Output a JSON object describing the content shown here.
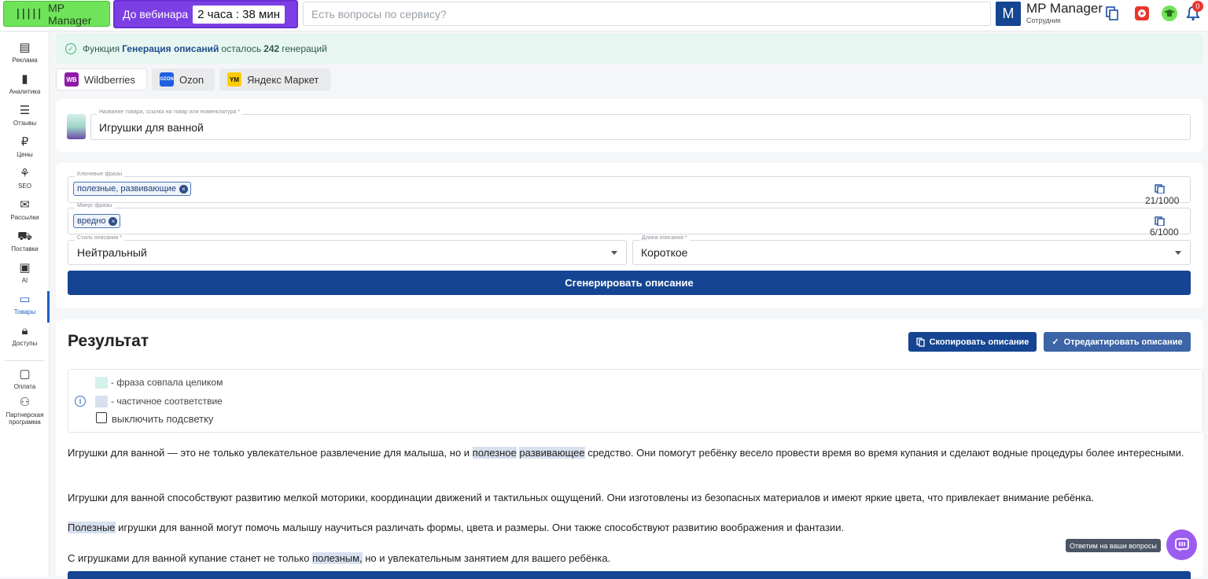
{
  "topbar": {
    "logo_label": "MP Manager",
    "webinar_label": "До вебинара",
    "webinar_timer": "2 часа : 38 мин",
    "search_placeholder": "Есть вопросы по сервису?",
    "user_initial": "M",
    "user_name": "MP Manager",
    "user_role": "Сотрудник",
    "notifications_count": "0"
  },
  "sidebar": {
    "items": [
      {
        "label": "Реклама",
        "icon": "ads-icon"
      },
      {
        "label": "Аналитика",
        "icon": "chart-icon"
      },
      {
        "label": "Отзывы",
        "icon": "reviews-icon"
      },
      {
        "label": "Цены",
        "icon": "ruble-icon"
      },
      {
        "label": "SEO",
        "icon": "seo-icon"
      },
      {
        "label": "Рассылки",
        "icon": "mail-icon"
      },
      {
        "label": "Поставки",
        "icon": "truck-icon"
      },
      {
        "label": "AI",
        "icon": "chip-icon"
      },
      {
        "label": "Товары",
        "icon": "box-icon"
      },
      {
        "label": "Доступы",
        "icon": "lock-icon"
      },
      {
        "label": "Оплата",
        "icon": "wallet-icon"
      },
      {
        "label": "Партнерская программа",
        "icon": "partners-icon"
      }
    ],
    "active": "Товары"
  },
  "banner": {
    "prefix": "Функция",
    "function_name": "Генерация описаний",
    "middle": "осталось",
    "count": "242",
    "suffix": "генераций"
  },
  "marketplaces": [
    {
      "label": "Wildberries",
      "logo": "WB",
      "color": "#8e1aa8"
    },
    {
      "label": "Ozon",
      "logo": "OZON",
      "color": "#1f5fe0"
    },
    {
      "label": "Яндекс Маркет",
      "logo": "YM",
      "color": "#ffcc00"
    }
  ],
  "product": {
    "label": "Название товара, ссылка на товар или номенклатура *",
    "value": "Игрушки для ванной"
  },
  "keywords": {
    "label": "Ключевые фразы",
    "chip": "полезные, развивающие",
    "counter": "21/1000"
  },
  "minus": {
    "label": "Минус фразы",
    "chip": "вредно",
    "counter": "6/1000"
  },
  "style": {
    "label": "Стиль описания *",
    "value": "Нейтральный"
  },
  "length": {
    "label": "Длина описания *",
    "value": "Короткое"
  },
  "generate_label": "Сгенерировать описание",
  "result": {
    "title": "Результат",
    "copy_label": "Скопировать описание",
    "edit_label": "Отредактировать описание",
    "legend_full": "- фраза совпала целиком",
    "legend_partial": "- частичное соответствие",
    "toggle_label": "выключить подсветку",
    "p1a": "Игрушки для ванной — это не только увлекательное развлечение для малыша, но и ",
    "p1h1": "полезное",
    "p1b": " ",
    "p1h2": "развивающее",
    "p1c": " средство. Они помогут ребёнку весело провести время во время купания и сделают водные процедуры более интересными.",
    "p2": "Игрушки для ванной способствуют развитию мелкой моторики, координации движений и тактильных ощущений. Они изготовлены из безопасных материалов и имеют яркие цвета, что привлекает внимание ребёнка.",
    "p3h": "Полезные",
    "p3": " игрушки для ванной могут помочь малышу научиться различать формы, цвета и размеры. Они также способствуют развитию воображения и фантазии.",
    "p4a": "С игрушками для ванной купание станет не только ",
    "p4h": "полезным,",
    "p4b": " но и увлекательным занятием для вашего ребёнка."
  },
  "help": {
    "tooltip": "Ответим на ваши вопросы"
  },
  "colors": {
    "primary": "#154592",
    "accent_green": "#6fe35a",
    "webinar_purple": "#7b3fe4",
    "highlight_full": "#d4f2ec",
    "highlight_partial": "#d7e0ee"
  }
}
